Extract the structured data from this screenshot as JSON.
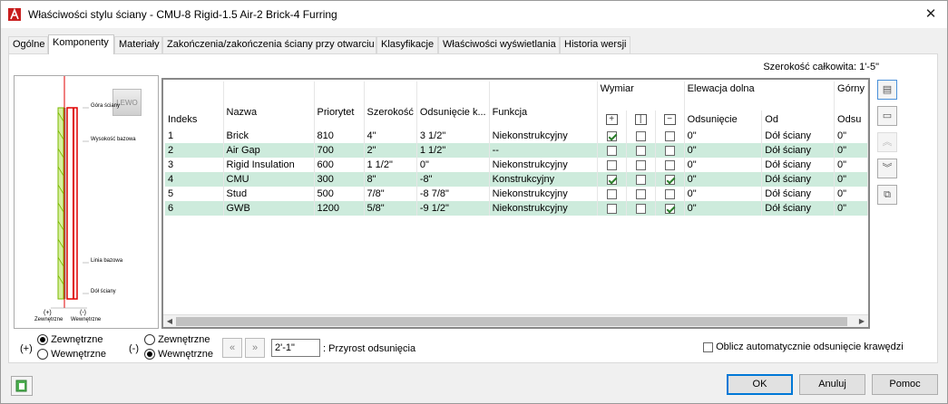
{
  "window": {
    "title": "Właściwości stylu ściany - CMU-8 Rigid-1.5 Air-2 Brick-4 Furring"
  },
  "tabs": [
    {
      "label": "Ogólne"
    },
    {
      "label": "Komponenty"
    },
    {
      "label": "Materiały"
    },
    {
      "label": "Zakończenia/zakończenia ściany przy otwarciu"
    },
    {
      "label": "Klasyfikacje"
    },
    {
      "label": "Właściwości wyświetlania"
    },
    {
      "label": "Historia wersji"
    }
  ],
  "total_width": "Szerokość całkowita: 1'-5\"",
  "preview": {
    "lewo_button": "LEWO",
    "labels": {
      "top_wall": "Góra ściany",
      "base_height": "Wysokość bazowa",
      "base_line": "Linia bazowa",
      "bottom_wall": "Dół ściany",
      "ext_sign": "(+)",
      "int_sign": "(-)",
      "ext_label": "Zewnętrzne",
      "int_label": "Wewnętrzne"
    }
  },
  "grid": {
    "header_group_1": {
      "wymiar": "Wymiar",
      "elevation_bottom": "Elewacja dolna",
      "elevation_top": "Górny"
    },
    "columns": {
      "index": "Indeks",
      "name": "Nazwa",
      "priority": "Priorytet",
      "width": "Szerokość",
      "offset": "Odsunięcie k...",
      "function": "Funkcja",
      "elev_offset": "Odsunięcie",
      "elev_from": "Od",
      "top_offset": "Odsu"
    },
    "rows": [
      {
        "index": "1",
        "name": "Brick",
        "priority": "810",
        "width": "4\"",
        "offset": "3 1/2\"",
        "function": "Niekonstrukcyjny",
        "d1": true,
        "d2": false,
        "d3": false,
        "elev_offset": "0\"",
        "elev_from": "Dół ściany",
        "top_offset": "0\""
      },
      {
        "index": "2",
        "name": "Air Gap",
        "priority": "700",
        "width": "2\"",
        "offset": "1 1/2\"",
        "function": "--",
        "d1": false,
        "d2": false,
        "d3": false,
        "elev_offset": "0\"",
        "elev_from": "Dół ściany",
        "top_offset": "0\""
      },
      {
        "index": "3",
        "name": "Rigid Insulation",
        "priority": "600",
        "width": "1 1/2\"",
        "offset": "0\"",
        "function": "Niekonstrukcyjny",
        "d1": false,
        "d2": false,
        "d3": false,
        "elev_offset": "0\"",
        "elev_from": "Dół ściany",
        "top_offset": "0\""
      },
      {
        "index": "4",
        "name": "CMU",
        "priority": "300",
        "width": "8\"",
        "offset": "-8\"",
        "function": "Konstrukcyjny",
        "d1": true,
        "d2": false,
        "d3": true,
        "elev_offset": "0\"",
        "elev_from": "Dół ściany",
        "top_offset": "0\""
      },
      {
        "index": "5",
        "name": "Stud",
        "priority": "500",
        "width": "7/8\"",
        "offset": "-8 7/8\"",
        "function": "Niekonstrukcyjny",
        "d1": false,
        "d2": false,
        "d3": false,
        "elev_offset": "0\"",
        "elev_from": "Dół ściany",
        "top_offset": "0\""
      },
      {
        "index": "6",
        "name": "GWB",
        "priority": "1200",
        "width": "5/8\"",
        "offset": "-9 1/2\"",
        "function": "Niekonstrukcyjny",
        "d1": false,
        "d2": false,
        "d3": true,
        "elev_offset": "0\"",
        "elev_from": "Dół ściany",
        "top_offset": "0\""
      }
    ]
  },
  "bottom": {
    "plus_sign": "(+)",
    "minus_sign": "(-)",
    "left_group": {
      "opt1": "Zewnętrzne",
      "opt2": "Wewnętrzne",
      "selected": "Zewnętrzne"
    },
    "right_group": {
      "opt1": "Zewnętrzne",
      "opt2": "Wewnętrzne",
      "selected": "Wewnętrzne"
    },
    "increment_value": "2'-1\"",
    "increment_label": ": Przyrost odsunięcia",
    "auto_offset_label": "Oblicz automatycznie odsunięcie krawędzi",
    "auto_offset_checked": false
  },
  "buttons": {
    "ok": "OK",
    "cancel": "Anuluj",
    "help": "Pomoc"
  },
  "colors": {
    "alt_row": "#cdebdc",
    "accent": "#0078d7",
    "wall_red": "#e00000",
    "wall_green": "#9acd32"
  }
}
